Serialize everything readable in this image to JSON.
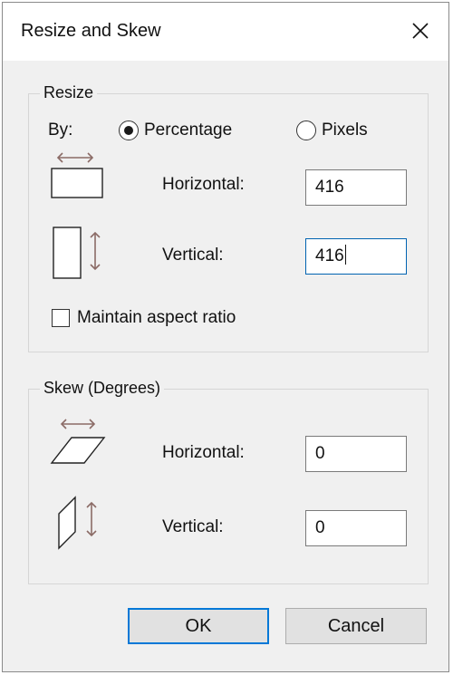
{
  "dialog": {
    "title": "Resize and Skew",
    "close_icon": "close-icon"
  },
  "resize": {
    "legend": "Resize",
    "by_label": "By:",
    "options": [
      {
        "label": "Percentage",
        "selected": true
      },
      {
        "label": "Pixels",
        "selected": false
      }
    ],
    "horizontal_label": "Horizontal:",
    "horizontal_value": "416",
    "vertical_label": "Vertical:",
    "vertical_value": "416",
    "maintain_label": "Maintain aspect ratio",
    "maintain_checked": false,
    "horizontal_icon": "resize-horizontal-icon",
    "vertical_icon": "resize-vertical-icon"
  },
  "skew": {
    "legend": "Skew (Degrees)",
    "horizontal_label": "Horizontal:",
    "horizontal_value": "0",
    "vertical_label": "Vertical:",
    "vertical_value": "0",
    "horizontal_icon": "skew-horizontal-icon",
    "vertical_icon": "skew-vertical-icon"
  },
  "buttons": {
    "ok": "OK",
    "cancel": "Cancel"
  },
  "colors": {
    "focus_border": "#0078d7",
    "dialog_bg": "#f0f0f0",
    "arrow": "#8b6b66"
  }
}
